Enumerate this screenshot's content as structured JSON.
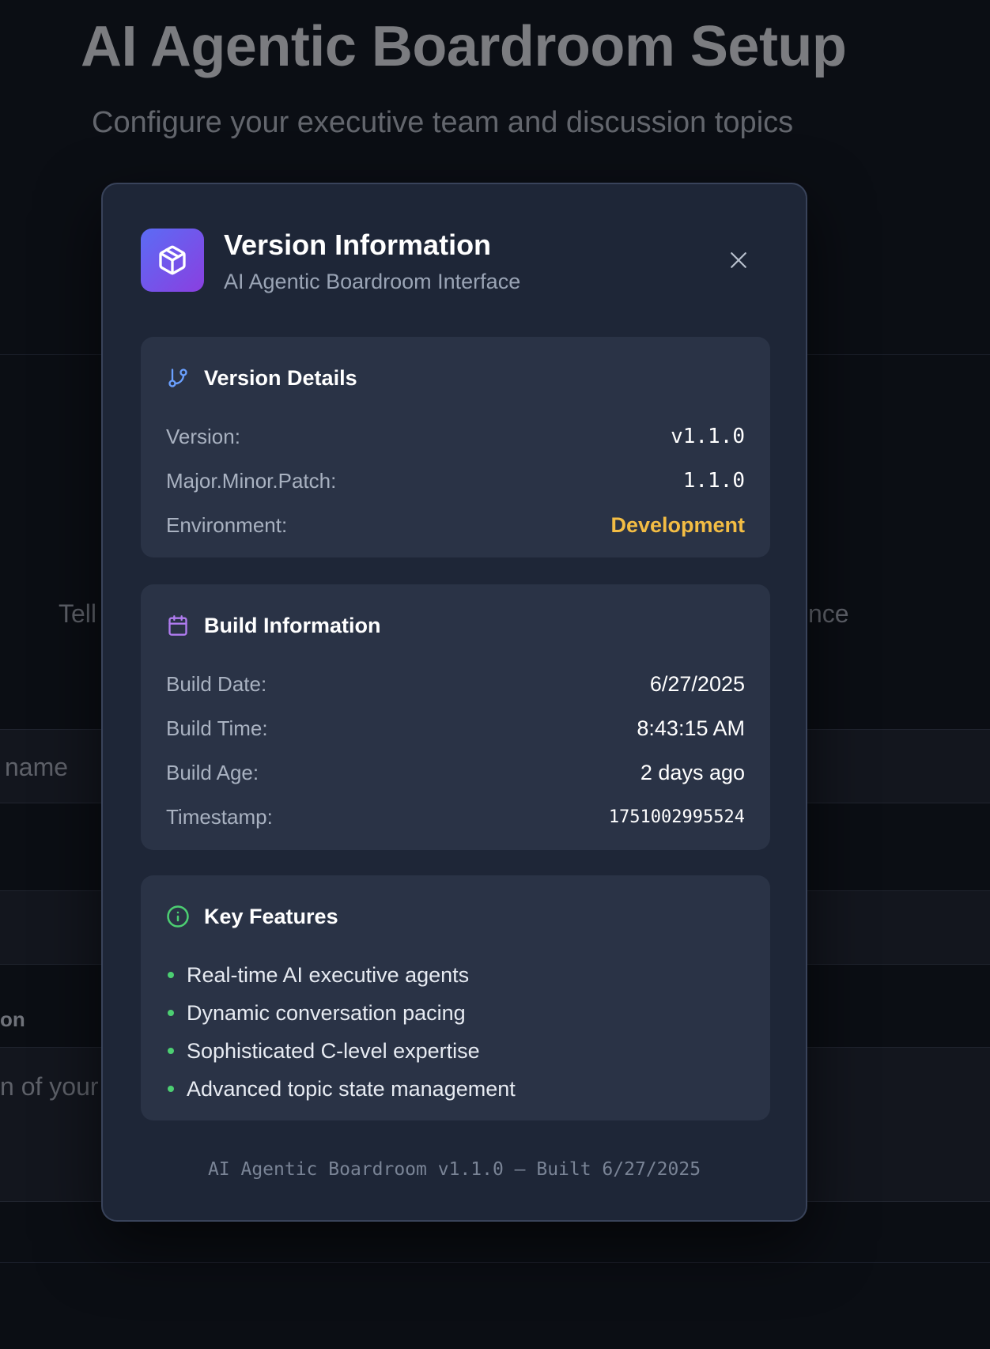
{
  "background": {
    "title": "AI Agentic Boardroom Setup",
    "subtitle": "Configure your executive team and discussion topics",
    "fragment_left": "Tell",
    "fragment_right": "nce",
    "input_fragment": "name",
    "label_fragment": "on",
    "textarea_fragment": "n of your"
  },
  "modal": {
    "title": "Version Information",
    "subtitle": "AI Agentic Boardroom Interface",
    "app_icon": "package-icon",
    "close_icon": "close-icon",
    "version_details": {
      "heading": "Version Details",
      "icon": "git-branch-icon",
      "rows": [
        {
          "label": "Version:",
          "value": "v1.1.0"
        },
        {
          "label": "Major.Minor.Patch:",
          "value": "1.1.0"
        },
        {
          "label": "Environment:",
          "value": "Development"
        }
      ]
    },
    "build_info": {
      "heading": "Build Information",
      "icon": "calendar-icon",
      "rows": [
        {
          "label": "Build Date:",
          "value": "6/27/2025"
        },
        {
          "label": "Build Time:",
          "value": "8:43:15 AM"
        },
        {
          "label": "Build Age:",
          "value": "2 days ago"
        },
        {
          "label": "Timestamp:",
          "value": "1751002995524"
        }
      ]
    },
    "key_features": {
      "heading": "Key Features",
      "icon": "info-icon",
      "items": [
        "Real-time AI executive agents",
        "Dynamic conversation pacing",
        "Sophisticated C-level expertise",
        "Advanced topic state management"
      ]
    },
    "footer": "AI Agentic Boardroom v1.1.0 – Built 6/27/2025"
  },
  "colors": {
    "page_bg": "#0b0e14",
    "modal_bg": "#1e2637",
    "card_bg": "#2a3346",
    "environment_accent": "#f3bd44",
    "bullet": "#4ccf72",
    "icon_gradient_start": "#5b6cf5",
    "icon_gradient_end": "#8a3fe0"
  }
}
